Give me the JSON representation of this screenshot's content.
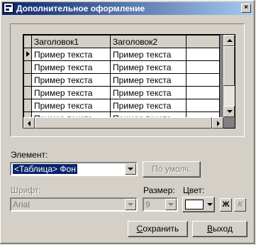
{
  "window": {
    "title": "Дополнительное оформление",
    "close_glyph": "×"
  },
  "grid": {
    "columns": [
      "Заголовок1",
      "Заголовок2",
      ""
    ],
    "rows": [
      [
        "Пример текста",
        "Пример текста",
        ""
      ],
      [
        "Пример текста",
        "Пример текста",
        ""
      ],
      [
        "Пример текста",
        "Пример текста",
        ""
      ],
      [
        "Пример текста",
        "Пример текста",
        ""
      ],
      [
        "Пример текста",
        "Пример текста",
        ""
      ],
      [
        "Пример текста",
        "Пример текста",
        ""
      ]
    ]
  },
  "element": {
    "label": "Элемент:",
    "value": "<Таблица> Фон"
  },
  "default_button": "По умолч.",
  "font": {
    "label": "Шрифт:",
    "value": "Arial"
  },
  "size": {
    "label": "Размер:",
    "value": "9"
  },
  "color": {
    "label": "Цвет:",
    "swatch": "#ffffff"
  },
  "bold_button": "Ж",
  "italic_button": "К",
  "save_button": {
    "underlined": "С",
    "rest": "охранить"
  },
  "exit_button": {
    "underlined": "В",
    "rest": "ыход"
  }
}
